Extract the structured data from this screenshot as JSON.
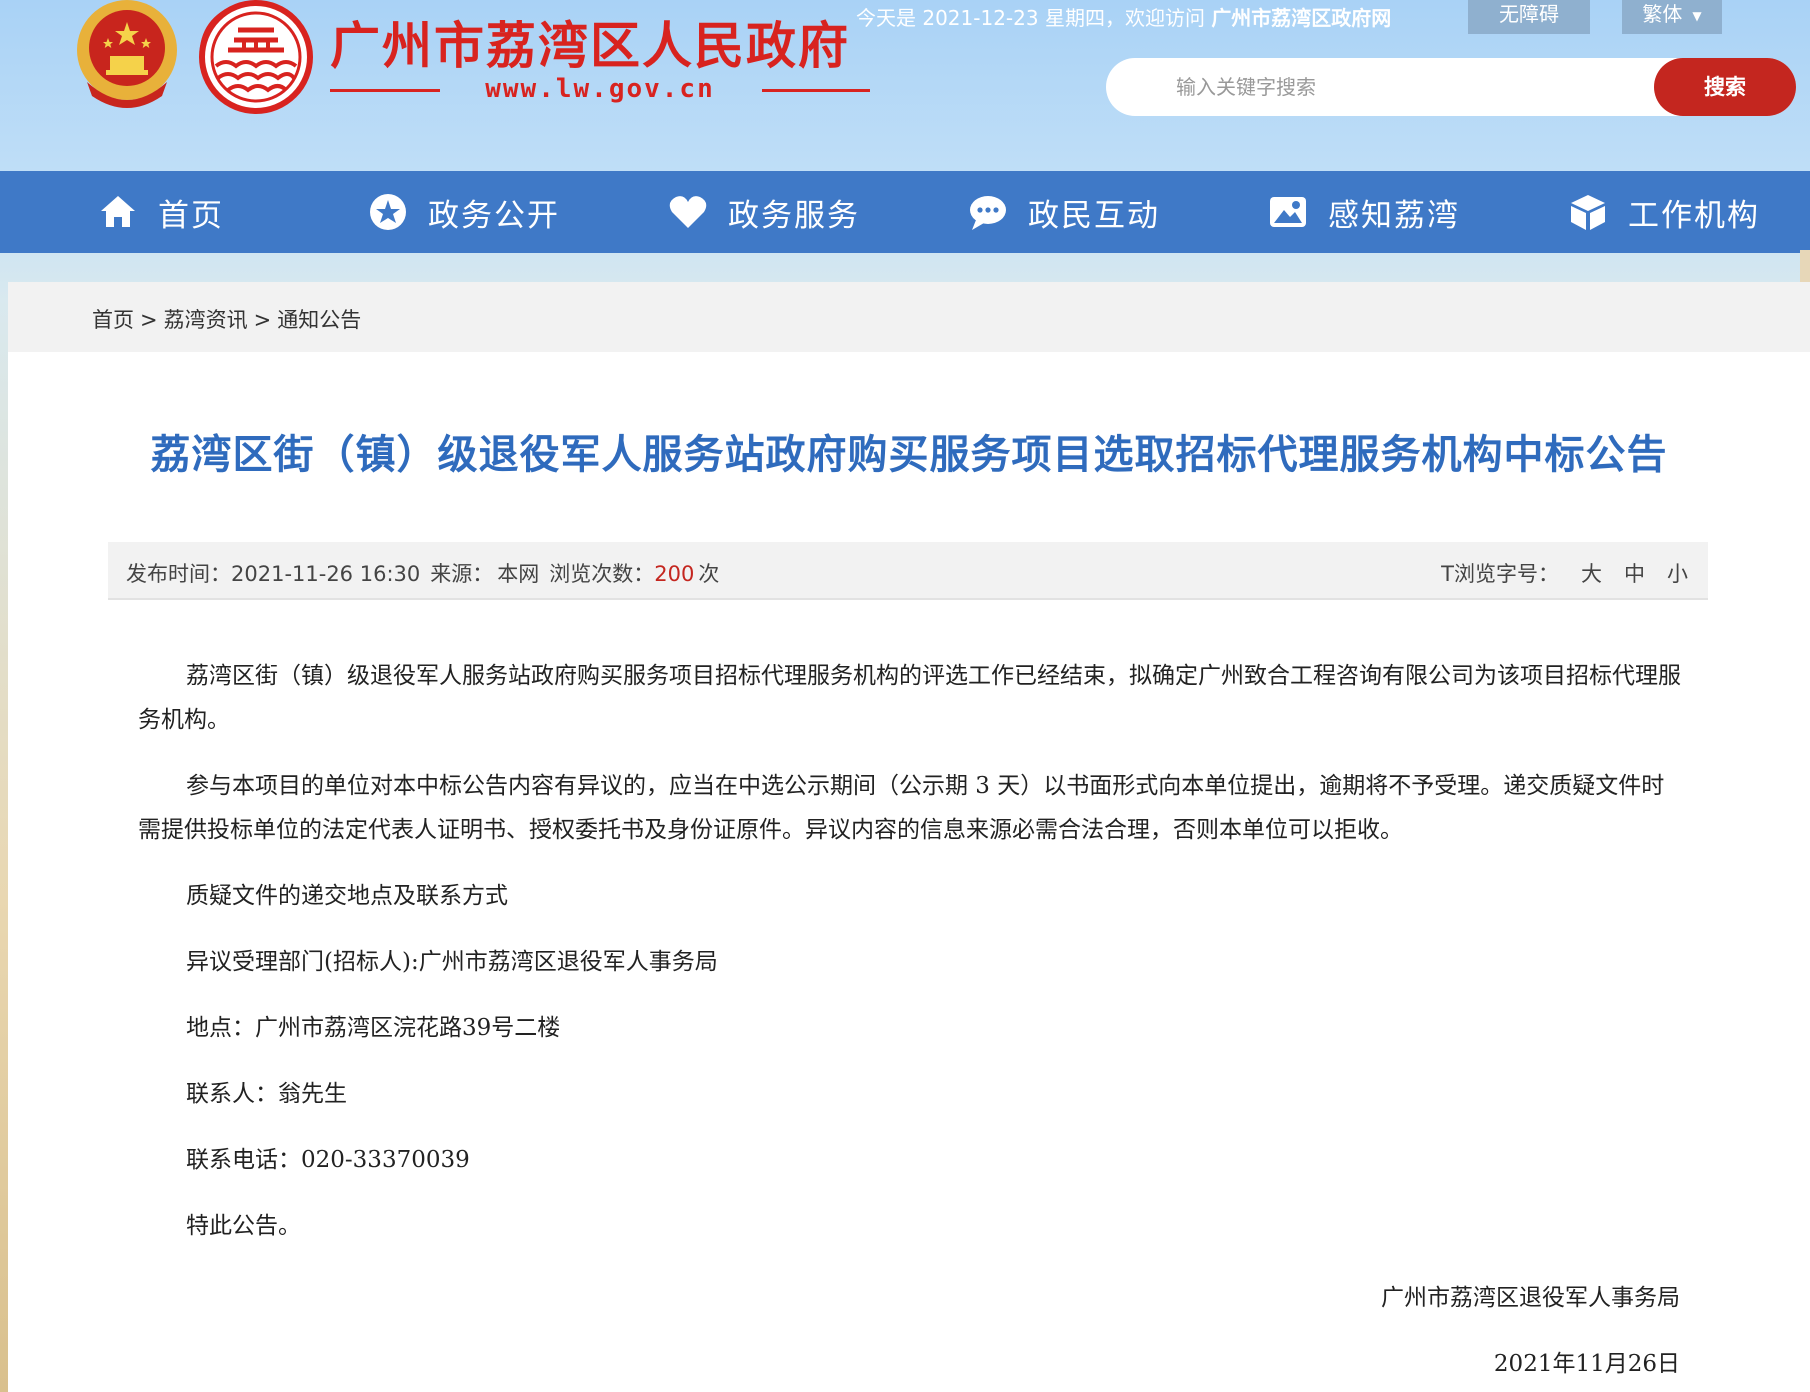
{
  "header": {
    "site_name": "广州市荔湾区人民政府",
    "site_url": "www.lw.gov.cn",
    "welcome_prefix": "今天是 2021-12-23 星期四，欢迎访问",
    "welcome_site": "广州市荔湾区政府网",
    "accessibility_label": "无障碍",
    "traditional_label": "繁体",
    "search_placeholder": "输入关键字搜索",
    "search_button": "搜索",
    "colors": {
      "brand_red": "#d8231f",
      "nav_blue": "#3f79c7",
      "title_blue": "#2f6bbd"
    }
  },
  "nav": {
    "items": [
      {
        "label": "首页",
        "icon": "home-icon"
      },
      {
        "label": "政务公开",
        "icon": "star-icon"
      },
      {
        "label": "政务服务",
        "icon": "heart-icon"
      },
      {
        "label": "政民互动",
        "icon": "chat-icon"
      },
      {
        "label": "感知荔湾",
        "icon": "image-icon"
      },
      {
        "label": "工作机构",
        "icon": "cube-icon"
      }
    ]
  },
  "breadcrumb": [
    "首页",
    "荔湾资讯",
    "通知公告"
  ],
  "article": {
    "title": "荔湾区街（镇）级退役军人服务站政府购买服务项目选取招标代理服务机构中标公告",
    "meta": {
      "publish_label": "发布时间：",
      "publish_time": "2021-11-26 16:30",
      "source_label": "来源：",
      "source": "本网",
      "views_label": "浏览次数：",
      "views": "200",
      "views_unit": "次",
      "fontsize_label": "T浏览字号：",
      "fontsize_options": [
        "大",
        "中",
        "小"
      ]
    },
    "paragraphs": [
      "荔湾区街（镇）级退役军人服务站政府购买服务项目招标代理服务机构的评选工作已经结束，拟确定广州致合工程咨询有限公司为该项目招标代理服务机构。",
      "参与本项目的单位对本中标公告内容有异议的，应当在中选公示期间（公示期 3 天）以书面形式向本单位提出，逾期将不予受理。递交质疑文件时需提供投标单位的法定代表人证明书、授权委托书及身份证原件。异议内容的信息来源必需合法合理，否则本单位可以拒收。",
      "质疑文件的递交地点及联系方式",
      "异议受理部门(招标人):广州市荔湾区退役军人事务局",
      "地点：广州市荔湾区浣花路39号二楼",
      "联系人：翁先生",
      "联系电话：020-33370039",
      "特此公告。"
    ],
    "signature_org": "广州市荔湾区退役军人事务局",
    "signature_date": "2021年11月26日"
  }
}
